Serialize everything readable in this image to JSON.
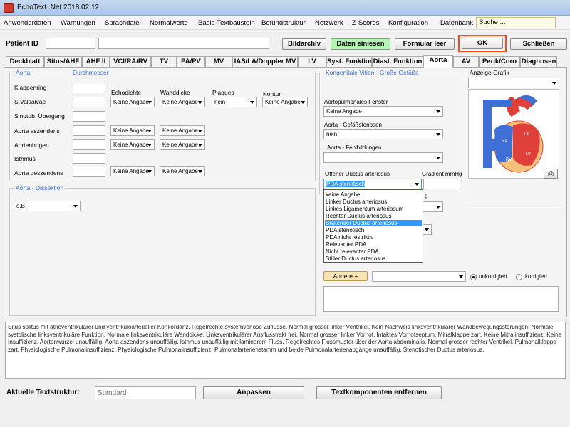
{
  "window": {
    "title": "EchoText .Net 2018.02.12"
  },
  "menu": [
    "Anwenderdaten",
    "Warnungen",
    "Sprachdatei",
    "Normalwerte",
    "Basis-Textbaustein",
    "Befundstruktur",
    "Netzwerk",
    "Z-Scores",
    "Konfiguration",
    "Datenbank"
  ],
  "search": {
    "value": "Suche ..."
  },
  "header": {
    "patient_label": "Patient ID",
    "buttons": {
      "bildarchiv": "Bildarchiv",
      "daten": "Daten einlesen",
      "formular": "Formular leer",
      "ok": "OK",
      "schliessen": "Schließen"
    }
  },
  "tabs": [
    "Deckblatt",
    "Situs/AHF",
    "AHF II",
    "VCI/RA/RV",
    "TV",
    "PA/PV",
    "MV",
    "IAS/LA/Doppler MV",
    "LV",
    "Syst. Funktion",
    "Diast. Funktion",
    "Aorta",
    "AV",
    "Perik/Coro",
    "Diagnosen"
  ],
  "active_tab": "Aorta",
  "aorta": {
    "title": "Aorta",
    "durchmesser": "Durchmesser",
    "col_headers": [
      "Echodichte",
      "Wanddicke",
      "Plaques",
      "Kontur"
    ],
    "rows": [
      {
        "label": "Klappenring"
      },
      {
        "label": "S.Valsalvae",
        "echo": "Keine Angabe",
        "wand": "Keine Angabe",
        "plaques": "nein",
        "kontur": "Keine Angabe"
      },
      {
        "label": "Sinutub. Übergang"
      },
      {
        "label": "Aorta aszendens",
        "echo": "Keine Angabe",
        "wand": "Keine Angabe"
      },
      {
        "label": "Aortenbogen",
        "echo": "Keine Angabe",
        "wand": "Keine Angabe"
      },
      {
        "label": "Isthmus"
      },
      {
        "label": "Aorta deszendens",
        "echo": "Keine Angabe",
        "wand": "Keine Angabe"
      }
    ]
  },
  "dissektion": {
    "title": "Aorta - Dissektion",
    "value": "o.B."
  },
  "vitien": {
    "title": "Kongenitale Vitien - Große Gefäße",
    "apf_label": "Aortopulmonales Fenster",
    "apf_value": "Keine Angabe",
    "stenosen_label": "Aorta - Gefäßstenosen",
    "stenosen_value": "nein",
    "fehl_label": "Aorta - Fehlbildungen",
    "pda_label": "Offener Ductus arteriosus",
    "pda_value": "PDA stenotisch",
    "gradient_label": "Gradient mmHg",
    "partial_label": "g",
    "dropdown_items": [
      "keine Angabe",
      "Linker Ductus arteriosus",
      "Linkes Ligamentum arteriosum",
      "Rechter Ductus arteriosus",
      "Bilateraler Ductus arteriosus",
      "PDA stenotisch",
      "PDA nicht restriktiv",
      "Relevanter PDA",
      "Nicht relevanter PDA",
      "Stiller Ductus arteriosus"
    ],
    "dropdown_highlight": "Bilateraler Ductus arteriosus",
    "andere_button": "Andere +",
    "radio_unkorr": "unkorrigiert",
    "radio_korr": "korrigiert"
  },
  "grafik": {
    "title": "Anzeige Grafik",
    "labels": [
      "RA",
      "RV",
      "LA",
      "LV"
    ]
  },
  "report_text": "Situs solitus mit atrioventrikulärer und ventrikuloarterieller Konkordanz. Regelrechte systemvenöse Zuflüsse. Normal grosser linker Ventrikel. Kein Nachweis linksventrikulärer Wandbewegungsstörungen. Normale systolische linksventrikuläre Funktion. Normale linksventrikuläre Wanddicke. Linksventrikulärer Ausflusstrakt frei. Normal grosser linker Vorhof. Intaktes Vorhofseptum. Mitralklappe zart. Keine Mitralinsuffizienz. Keine Insuffizienz. Aortenwurzel unauffällig. Aorta aszendens unauffällig. Isthmus unauffällig mit laminarem Fluss. Regelrechtes Flussmuster über der Aorta abdominalis. Normal grosser rechter Ventrikel. Pulmonalklappe zart. Physiologische Pulmonalinsuffizienz. Physiologische Pulmonalinsuffizienz. Pulmonalarterienstamm und beide Pulmonalarterienabgänge unauffällig. Stenotischer Ductus arteriosus.",
  "footer": {
    "label": "Aktuelle Textstruktur:",
    "value": "Standard",
    "anpassen": "Anpassen",
    "entfernen": "Textkomponenten entfernen"
  }
}
